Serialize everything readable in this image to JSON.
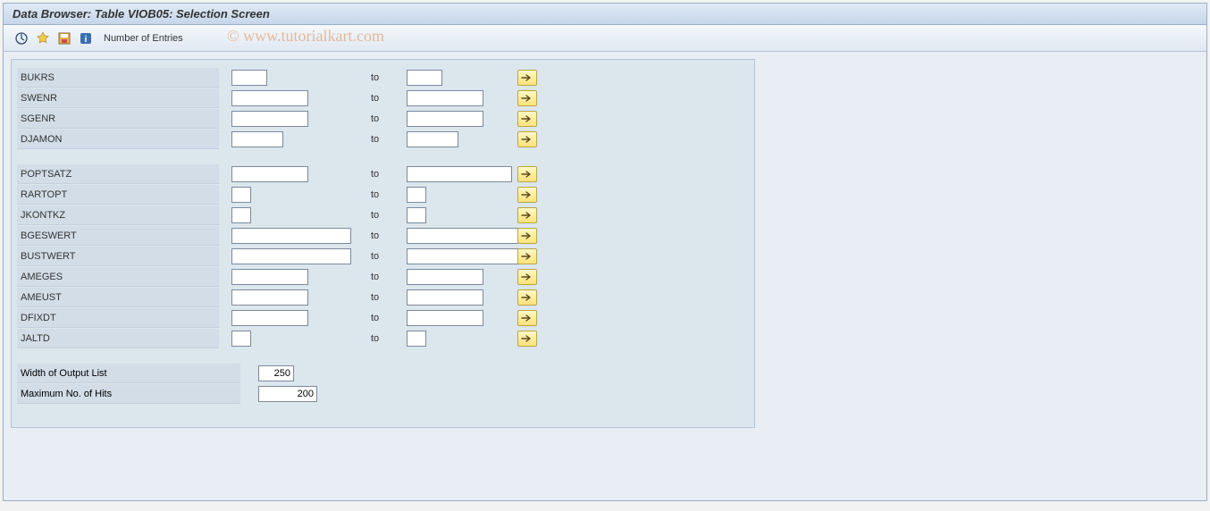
{
  "title": "Data Browser: Table VIOB05: Selection Screen",
  "toolbar": {
    "entries_label": "Number of Entries"
  },
  "watermark": "© www.tutorialkart.com",
  "to_label": "to",
  "group1": [
    {
      "label": "BUKRS",
      "wf": "w-s",
      "wt": "w-s"
    },
    {
      "label": "SWENR",
      "wf": "w-l",
      "wt": "w-l"
    },
    {
      "label": "SGENR",
      "wf": "w-l",
      "wt": "w-l"
    },
    {
      "label": "DJAMON",
      "wf": "w-m",
      "wt": "w-m"
    }
  ],
  "group2": [
    {
      "label": "POPTSATZ",
      "wf": "w-l",
      "wt": "w-xl"
    },
    {
      "label": "RARTOPT",
      "wf": "w-xs",
      "wt": "w-xs"
    },
    {
      "label": "JKONTKZ",
      "wf": "w-xs",
      "wt": "w-xs"
    },
    {
      "label": "BGESWERT",
      "wf": "w-xxl",
      "wt": "w-xxl"
    },
    {
      "label": "BUSTWERT",
      "wf": "w-xxl",
      "wt": "w-xxl"
    },
    {
      "label": "AMEGES",
      "wf": "w-l",
      "wt": "w-l"
    },
    {
      "label": "AMEUST",
      "wf": "w-l",
      "wt": "w-l"
    },
    {
      "label": "DFIXDT",
      "wf": "w-l",
      "wt": "w-l"
    },
    {
      "label": "JALTD",
      "wf": "w-xs",
      "wt": "w-xs"
    }
  ],
  "bottom": {
    "width_label": "Width of Output List",
    "width_value": "250",
    "hits_label": "Maximum No. of Hits",
    "hits_value": "200"
  }
}
